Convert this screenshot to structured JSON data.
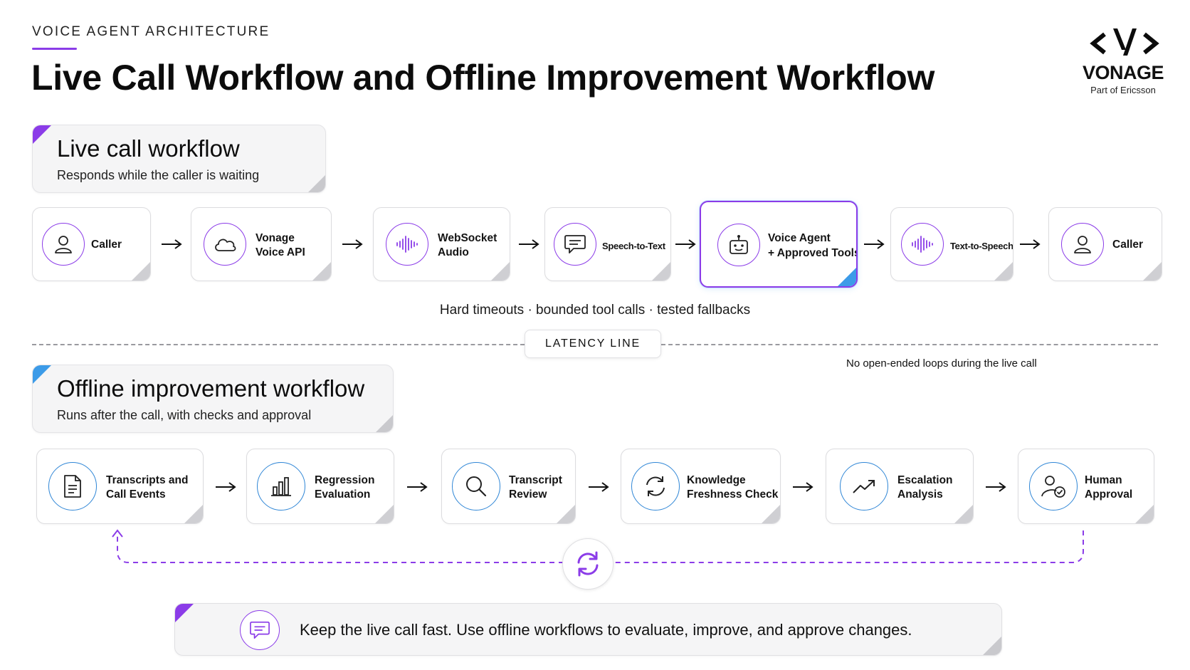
{
  "header": {
    "eyebrow": "VOICE AGENT ARCHITECTURE",
    "title": "Live Call Workflow and Offline Improvement Workflow"
  },
  "logo": {
    "word": "VONAGE",
    "sub": "Part of Ericsson"
  },
  "live": {
    "title": "Live call workflow",
    "subtitle": "Responds while the caller is waiting",
    "steps": [
      {
        "line1": "Caller",
        "line2": "",
        "icon": "person-icon"
      },
      {
        "line1": "Vonage",
        "line2": "Voice API",
        "icon": "cloud-icon"
      },
      {
        "line1": "WebSocket",
        "line2": "Audio",
        "icon": "waveform-icon"
      },
      {
        "line1": "Speech-to-Text",
        "line2": "",
        "icon": "chat-bubble-icon"
      },
      {
        "line1": "Voice Agent",
        "line2": "+ Approved Tools",
        "icon": "robot-icon"
      },
      {
        "line1": "Text-to-Speech",
        "line2": "",
        "icon": "waveform-icon"
      },
      {
        "line1": "Caller",
        "line2": "",
        "icon": "person-icon"
      }
    ],
    "caption": "Hard timeouts  ·  bounded tool calls  ·  tested fallbacks"
  },
  "latency": {
    "label": "LATENCY LINE",
    "note": "No open-ended loops during the live call"
  },
  "offline": {
    "title": "Offline improvement workflow",
    "subtitle": "Runs after the call, with checks and approval",
    "steps": [
      {
        "line1": "Transcripts and",
        "line2": "Call Events",
        "icon": "document-icon"
      },
      {
        "line1": "Regression",
        "line2": "Evaluation",
        "icon": "bar-chart-icon"
      },
      {
        "line1": "Transcript",
        "line2": "Review",
        "icon": "magnifier-icon"
      },
      {
        "line1": "Knowledge",
        "line2": "Freshness Check",
        "icon": "refresh-icon"
      },
      {
        "line1": "Escalation",
        "line2": "Analysis",
        "icon": "trend-up-icon"
      },
      {
        "line1": "Human",
        "line2": "Approval",
        "icon": "user-check-icon"
      }
    ]
  },
  "banner": {
    "text": "Keep the live call fast. Use offline workflows to evaluate, improve, and approve changes."
  },
  "colors": {
    "accent_purple": "#8b3ce8",
    "accent_blue": "#2f86d6",
    "section_bg": "#f5f5f6"
  }
}
